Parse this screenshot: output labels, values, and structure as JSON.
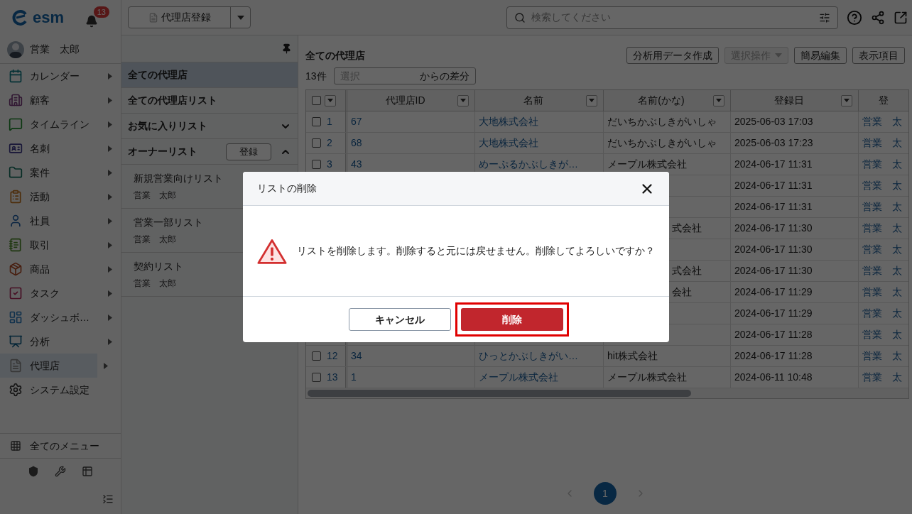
{
  "app": {
    "logo": "esm",
    "notification_count": "13",
    "user": "営業　太郎"
  },
  "nav": [
    {
      "label": "カレンダー",
      "kind": "calendar",
      "submenu": true,
      "selected": false
    },
    {
      "label": "顧客",
      "kind": "customer",
      "submenu": true,
      "selected": false
    },
    {
      "label": "タイムライン",
      "kind": "timeline",
      "submenu": true,
      "selected": false
    },
    {
      "label": "名刺",
      "kind": "card",
      "submenu": true,
      "selected": false
    },
    {
      "label": "案件",
      "kind": "deal",
      "submenu": true,
      "selected": false
    },
    {
      "label": "活動",
      "kind": "activity",
      "submenu": true,
      "selected": false
    },
    {
      "label": "社員",
      "kind": "employee",
      "submenu": true,
      "selected": false
    },
    {
      "label": "取引",
      "kind": "trade",
      "submenu": true,
      "selected": false
    },
    {
      "label": "商品",
      "kind": "product",
      "submenu": true,
      "selected": false
    },
    {
      "label": "タスク",
      "kind": "task",
      "submenu": true,
      "selected": false
    },
    {
      "label": "ダッシュボ…",
      "kind": "dashboard",
      "submenu": true,
      "selected": false
    },
    {
      "label": "分析",
      "kind": "analysis",
      "submenu": true,
      "selected": false
    },
    {
      "label": "代理店",
      "kind": "agency",
      "submenu": true,
      "selected": true
    },
    {
      "label": "システム設定",
      "kind": "settings",
      "submenu": false,
      "selected": false
    }
  ],
  "sidebar_footer": {
    "all_menu": "全てのメニュー"
  },
  "toolbar": {
    "create_button": "代理店登録",
    "search_placeholder": "検索してください"
  },
  "list_panel": {
    "items": [
      {
        "label": "全ての代理店",
        "selected": true
      },
      {
        "label": "全ての代理店リスト",
        "selected": false
      }
    ],
    "sections": [
      {
        "label": "お気に入りリスト",
        "expanded": false
      },
      {
        "label": "オーナーリスト",
        "expanded": true,
        "button": "登録",
        "lists": [
          {
            "name": "新規営業向けリスト",
            "owner": "営業　太郎"
          },
          {
            "name": "営業一部リスト",
            "owner": "営業　太郎"
          },
          {
            "name": "契約リスト",
            "owner": "営業　太郎"
          }
        ]
      }
    ]
  },
  "main": {
    "title": "全ての代理店",
    "count": "13件",
    "diff": {
      "placeholder": "選択",
      "suffix": "からの差分"
    },
    "buttons": [
      {
        "label": "分析用データ作成",
        "disabled": false,
        "dropdown": false
      },
      {
        "label": "選択操作",
        "disabled": true,
        "dropdown": true
      },
      {
        "label": "簡易編集",
        "disabled": false,
        "dropdown": false
      },
      {
        "label": "表示項目",
        "disabled": false,
        "dropdown": false
      }
    ]
  },
  "table": {
    "select_all_checked": false,
    "columns": [
      "代理店ID",
      "名前",
      "名前(かな)",
      "登録日",
      "登"
    ],
    "rows": [
      {
        "kind": "full",
        "no": "1",
        "checked": false,
        "id": "67",
        "name": "大地株式会社",
        "kana": "だいちかぶしきがいしゃ",
        "date": "2025-06-03 17:03",
        "owner": "営業　太"
      },
      {
        "kind": "full",
        "no": "2",
        "checked": false,
        "id": "68",
        "name": "大地株式会社",
        "kana": "だいちかぶしきがいしゃ",
        "date": "2025-06-03 17:23",
        "owner": "営業　太"
      },
      {
        "kind": "full",
        "no": "3",
        "checked": false,
        "id": "43",
        "name": "めーぷるかぶしきが…",
        "kana": "メープル株式会社",
        "date": "2024-06-17 11:31",
        "owner": "営業　太"
      },
      {
        "kind": "covered",
        "date": "2024-06-17 11:31",
        "owner": "営業　太"
      },
      {
        "kind": "covered",
        "date": "2024-06-17 11:31",
        "owner": "営業　太"
      },
      {
        "kind": "covered",
        "kana": "式会社",
        "date": "2024-06-17 11:30",
        "owner": "営業　太"
      },
      {
        "kind": "covered",
        "date": "2024-06-17 11:30",
        "owner": "営業　太"
      },
      {
        "kind": "covered",
        "kana": "式会社",
        "date": "2024-06-17 11:30",
        "owner": "営業　太"
      },
      {
        "kind": "covered",
        "kana": "会社",
        "date": "2024-06-17 11:29",
        "owner": "営業　太"
      },
      {
        "kind": "covered",
        "date": "2024-06-17 11:29",
        "owner": "営業　太"
      },
      {
        "kind": "covered",
        "date": "2024-06-17 11:28",
        "owner": "営業　太"
      },
      {
        "kind": "full",
        "no": "12",
        "checked": false,
        "id": "34",
        "name": "ひっとかぶしきがい…",
        "kana": "hit株式会社",
        "date": "2024-06-17 11:28",
        "owner": "営業　太"
      },
      {
        "kind": "full",
        "no": "13",
        "checked": false,
        "id": "1",
        "name": "メープル株式会社",
        "kana": "メープル株式会社",
        "date": "2024-06-11 10:48",
        "owner": "営業　太"
      }
    ]
  },
  "pagination": {
    "pages": [
      {
        "label": "1",
        "selected": true
      }
    ]
  },
  "dialog": {
    "title": "リストの削除",
    "message": "リストを削除します。削除すると元には戻せません。削除してよろしいですか？",
    "cancel": "キャンセル",
    "confirm": "削除",
    "confirm_highlighted": true
  }
}
